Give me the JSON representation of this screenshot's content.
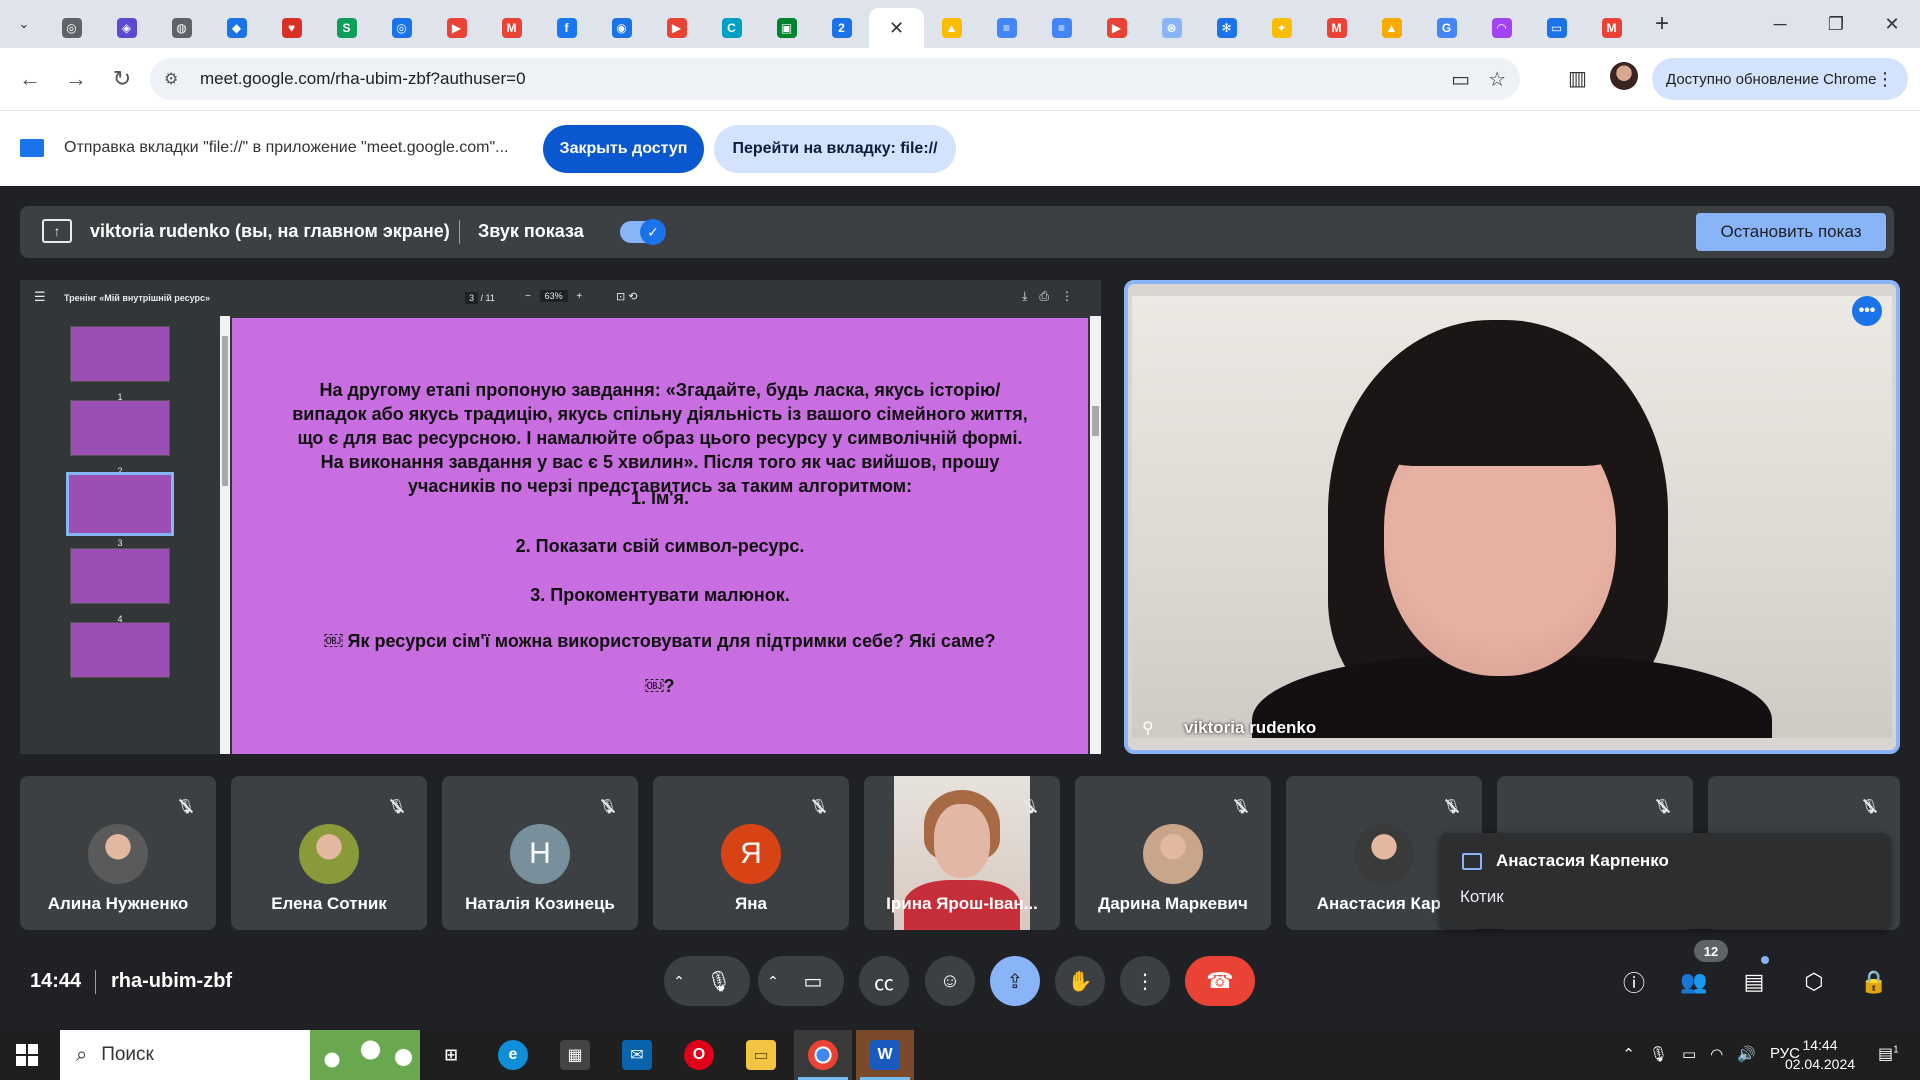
{
  "browser": {
    "tabs": [
      {
        "icon": "chrome-icon",
        "color": "#5f6368",
        "glyph": "◎"
      },
      {
        "icon": "shield-icon",
        "color": "#5b4bd1",
        "glyph": "◈"
      },
      {
        "icon": "globe-icon",
        "color": "#5f6368",
        "glyph": "◍"
      },
      {
        "icon": "diamond-icon",
        "color": "#1a73e8",
        "glyph": "◆"
      },
      {
        "icon": "heart-icon",
        "color": "#d93025",
        "glyph": "♥"
      },
      {
        "icon": "sheet-icon",
        "color": "#0f9d58",
        "glyph": "S"
      },
      {
        "icon": "blue-circle-icon",
        "color": "#1a73e8",
        "glyph": "◎"
      },
      {
        "icon": "youtube-icon",
        "color": "#ea4335",
        "glyph": "▶"
      },
      {
        "icon": "gmail-icon",
        "color": "#ea4335",
        "glyph": "M"
      },
      {
        "icon": "facebook-icon",
        "color": "#1877f2",
        "glyph": "f"
      },
      {
        "icon": "target-icon",
        "color": "#1a73e8",
        "glyph": "◉"
      },
      {
        "icon": "youtube-icon",
        "color": "#ea4335",
        "glyph": "▶"
      },
      {
        "icon": "c-icon",
        "color": "#00a0c6",
        "glyph": "C"
      },
      {
        "icon": "meet-icon",
        "color": "#00832d",
        "glyph": "▣"
      },
      {
        "icon": "calendar-icon",
        "color": "#1a73e8",
        "glyph": "2"
      }
    ],
    "tabs_after": [
      {
        "icon": "drive-icon",
        "color": "#fbbc04",
        "glyph": "▲"
      },
      {
        "icon": "docs-icon",
        "color": "#4285f4",
        "glyph": "≡"
      },
      {
        "icon": "docs-icon",
        "color": "#4285f4",
        "glyph": "≡"
      },
      {
        "icon": "youtube-icon",
        "color": "#ea4335",
        "glyph": "▶"
      },
      {
        "icon": "settings-icon",
        "color": "#8ab4f8",
        "glyph": "⊛"
      },
      {
        "icon": "snowflake-icon",
        "color": "#1a73e8",
        "glyph": "✻"
      },
      {
        "icon": "bookmark-icon",
        "color": "#fbbc04",
        "glyph": "✦"
      },
      {
        "icon": "gmail-icon",
        "color": "#ea4335",
        "glyph": "M"
      },
      {
        "icon": "alert-icon",
        "color": "#f9ab00",
        "glyph": "▲"
      },
      {
        "icon": "google-icon",
        "color": "#4285f4",
        "glyph": "G"
      },
      {
        "icon": "loop-icon",
        "color": "#a142f4",
        "glyph": "◠"
      },
      {
        "icon": "screen-icon",
        "color": "#1a73e8",
        "glyph": "▭"
      },
      {
        "icon": "gmail-icon",
        "color": "#ea4335",
        "glyph": "M"
      }
    ],
    "url": "meet.google.com/rha-ubim-zbf?authuser=0",
    "update_label": "Доступно обновление Chrome"
  },
  "share_bar": {
    "message": "Отправка вкладки \"file://\" в приложение \"meet.google.com\"...",
    "close_access": "Закрыть доступ",
    "go_to_tab": "Перейти на вкладку: file://"
  },
  "presenting": {
    "label": "viktoria rudenko (вы, на главном экране)",
    "sound_label": "Звук показа",
    "sound_on": true,
    "stop_label": "Остановить показ"
  },
  "pdf": {
    "title": "Тренінг «Мій внутрішній ресурс»",
    "page": "3",
    "pages": "/ 11",
    "zoom": "63%",
    "thumb_numbers": [
      "1",
      "2",
      "3",
      "4"
    ],
    "selected_page": 3,
    "slide_paragraph": "На другому етапі  пропоную завдання: «Згадайте, будь ласка, якусь історію/ випадок або якусь традицію, якусь спільну діяльність із вашого сімейного життя, що є для вас ресурсною. І намалюйте образ цього ресурсу у символічній формі. На виконання завдання у вас є 5 хвилин». Після того як час вийшов, прошу учасників по черзі представитись за таким алгоритмом:",
    "slide_items": [
      "1. Ім'я.",
      "2. Показати свій символ-ресурс.",
      "3. Прокоментувати малюнок.",
      "￼ Як ресурси сім'ї можна використовувати для підтримки себе? Які саме?",
      "￼?"
    ]
  },
  "presenter": {
    "name": "viktoria rudenko"
  },
  "participants": [
    {
      "name": "Алина Нужненко",
      "avatar": "photo",
      "color": "#5a5a5a",
      "initial": ""
    },
    {
      "name": "Елена Сотник",
      "avatar": "photo",
      "color": "#8a9a3a",
      "initial": ""
    },
    {
      "name": "Наталія Козинець",
      "avatar": "initial",
      "color": "#78909c",
      "initial": "Н"
    },
    {
      "name": "Яна",
      "avatar": "initial",
      "color": "#d84315",
      "initial": "Я"
    },
    {
      "name": "Ірина Ярош-Іван...",
      "avatar": "video",
      "color": "",
      "initial": ""
    },
    {
      "name": "Дарина Маркевич",
      "avatar": "photo",
      "color": "#c9a58a",
      "initial": ""
    },
    {
      "name": "Анастасия Карп",
      "avatar": "photo",
      "color": "#3a3a3a",
      "initial": ""
    },
    {
      "name": "",
      "avatar": "none",
      "color": "",
      "initial": ""
    },
    {
      "name": "",
      "avatar": "none",
      "color": "",
      "initial": ""
    }
  ],
  "chat_toast": {
    "sender": "Анастасия Карпенко",
    "text": "Котик"
  },
  "meet_bar": {
    "time": "14:44",
    "code": "rha-ubim-zbf",
    "participant_count": "12"
  },
  "taskbar": {
    "search_placeholder": "Поиск",
    "language": "РУС",
    "time": "14:44",
    "date": "02.04.2024",
    "notifications": "1"
  }
}
